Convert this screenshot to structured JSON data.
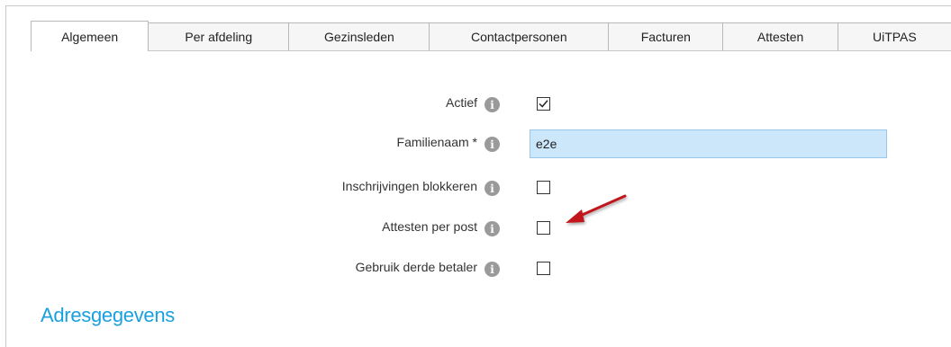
{
  "tabs": [
    {
      "label": "Algemeen",
      "active": true
    },
    {
      "label": "Per afdeling",
      "active": false
    },
    {
      "label": "Gezinsleden",
      "active": false
    },
    {
      "label": "Contactpersonen",
      "active": false
    },
    {
      "label": "Facturen",
      "active": false
    },
    {
      "label": "Attesten",
      "active": false
    },
    {
      "label": "UiTPAS",
      "active": false
    }
  ],
  "form": {
    "actief": {
      "label": "Actief",
      "checked": true
    },
    "familienaam": {
      "label": "Familienaam *",
      "value": "e2e"
    },
    "inschrijvingen_blokkeren": {
      "label": "Inschrijvingen blokkeren",
      "checked": false
    },
    "attesten_per_post": {
      "label": "Attesten per post",
      "checked": false
    },
    "gebruik_derde_betaler": {
      "label": "Gebruik derde betaler",
      "checked": false
    }
  },
  "info_icon_glyph": "i",
  "section": {
    "title": "Adresgegevens"
  },
  "colors": {
    "accent": "#1aa0e0",
    "input_bg": "#cce6fa",
    "arrow": "#c0161e"
  }
}
